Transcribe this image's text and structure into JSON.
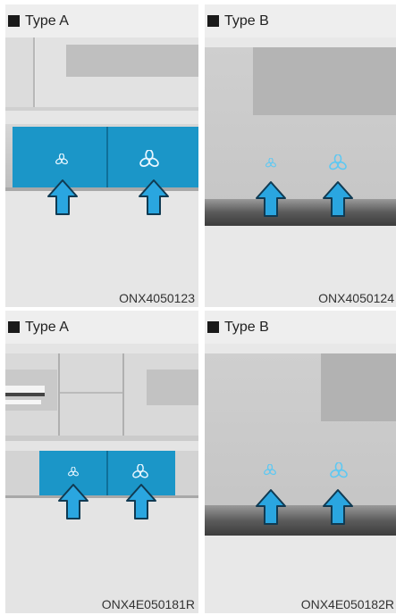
{
  "panels": [
    {
      "title": "Type A",
      "code": "ONX4050123"
    },
    {
      "title": "Type B",
      "code": "ONX4050124"
    },
    {
      "title": "Type A",
      "code": "ONX4E050181R"
    },
    {
      "title": "Type B",
      "code": "ONX4E050182R"
    }
  ],
  "icons": {
    "fan_low": "fan-low-icon",
    "fan_high": "fan-high-icon",
    "arrow": "up-arrow-icon"
  },
  "colors": {
    "button_blue": "#1b96c8",
    "arrow_blue": "#2aa6e0",
    "panel_grey": "#e9e9e9"
  }
}
